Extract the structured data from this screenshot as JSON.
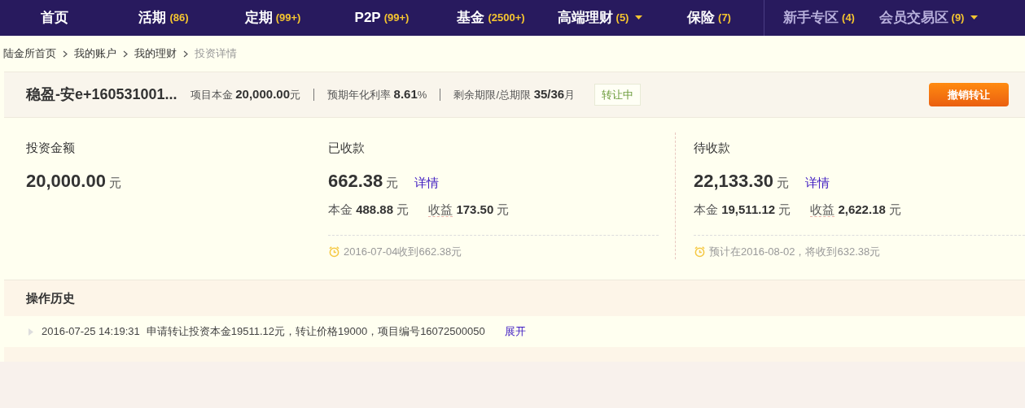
{
  "nav": {
    "items": [
      {
        "label": "首页",
        "kind": "main",
        "dropdown": false
      },
      {
        "label": "活期",
        "count": "(86)",
        "kind": "main",
        "dropdown": false
      },
      {
        "label": "定期",
        "count": "(99+)",
        "kind": "main",
        "dropdown": false
      },
      {
        "label": "P2P",
        "count": "(99+)",
        "kind": "main",
        "dropdown": false
      },
      {
        "label": "基金",
        "count": "(2500+)",
        "kind": "main",
        "dropdown": false
      },
      {
        "label": "高端理财",
        "count": "(5)",
        "kind": "main",
        "dropdown": true
      },
      {
        "label": "保险",
        "count": "(7)",
        "kind": "main",
        "dropdown": false
      },
      {
        "label": "新手专区",
        "count": "(4)",
        "kind": "secondary",
        "dropdown": false
      },
      {
        "label": "会员交易区",
        "count": "(9)",
        "kind": "secondary",
        "dropdown": true
      }
    ]
  },
  "breadcrumb": [
    "陆金所首页",
    "我的账户",
    "我的理财",
    "投资详情"
  ],
  "product": {
    "name": "稳盈-安e+160531001...",
    "facts": [
      {
        "label": "项目本金",
        "value": "20,000.00",
        "unit": "元"
      },
      {
        "label": "预期年化利率",
        "value": "8.61",
        "unit": "%"
      },
      {
        "label": "剩余期限/总期限",
        "value": "35/36",
        "unit": "月"
      }
    ],
    "status": "转让中",
    "action": "撤销转让"
  },
  "stats": [
    {
      "title": "投资金额",
      "amount": "20,000.00",
      "unit": "元"
    },
    {
      "title": "已收款",
      "amount": "662.38",
      "unit": "元",
      "link": "详情",
      "principal_label": "本金",
      "principal": "488.88",
      "principal_unit": "元",
      "income_label": "收益",
      "income": "173.50",
      "income_unit": "元",
      "note": "2016-07-04收到662.38元"
    },
    {
      "title": "待收款",
      "amount": "22,133.30",
      "unit": "元",
      "link": "详情",
      "principal_label": "本金",
      "principal": "19,511.12",
      "principal_unit": "元",
      "income_label": "收益",
      "income": "2,622.18",
      "income_unit": "元",
      "note": "预计在2016-08-02，将收到632.38元"
    }
  ],
  "history": {
    "title": "操作历史",
    "rows": [
      {
        "time": "2016-07-25 14:19:31",
        "text": "申请转让投资本金19511.12元，转让价格19000，项目编号16072500050",
        "link": "展开"
      }
    ]
  }
}
